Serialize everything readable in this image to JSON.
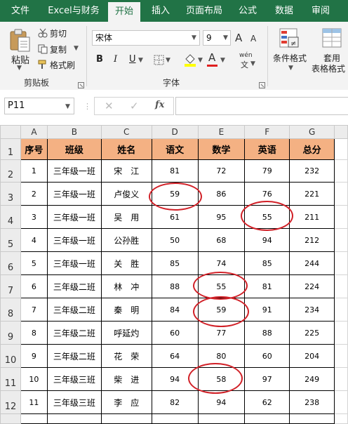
{
  "tabs": [
    "文件",
    "Excel与财务",
    "开始",
    "插入",
    "页面布局",
    "公式",
    "数据",
    "审阅"
  ],
  "clipboard": {
    "paste_label": "粘贴",
    "cut_label": "剪切",
    "copy_label": "复制",
    "format_painter_label": "格式刷",
    "group_label": "剪贴板"
  },
  "font": {
    "name_value": "宋体",
    "size_value": "9",
    "bold_label": "B",
    "italic_label": "I",
    "underline_label": "U",
    "grow_label": "A",
    "shrink_label": "A",
    "wen_label": "wén",
    "font_color_label": "A",
    "group_label": "字体"
  },
  "styles": {
    "conditional_label": "条件格式",
    "table_label_1": "套用",
    "table_label_2": "表格格式"
  },
  "formula_bar": {
    "name_box": "P11",
    "fx_label": "fx",
    "formula_value": ""
  },
  "colors": {
    "ribbon_green": "#217346",
    "header_fill": "#f4b183",
    "circle_red": "#d12027"
  },
  "sheet": {
    "columns": [
      "A",
      "B",
      "C",
      "D",
      "E",
      "F",
      "G"
    ],
    "row_numbers": [
      "1",
      "2",
      "3",
      "4",
      "5",
      "6",
      "7",
      "8",
      "9",
      "10",
      "11",
      "12"
    ],
    "headers": [
      "序号",
      "班级",
      "姓名",
      "语文",
      "数学",
      "英语",
      "总分"
    ],
    "rows": [
      [
        "1",
        "三年级一班",
        "宋　江",
        "81",
        "72",
        "79",
        "232"
      ],
      [
        "2",
        "三年级一班",
        "卢俊义",
        "59",
        "86",
        "76",
        "221"
      ],
      [
        "3",
        "三年级一班",
        "吴　用",
        "61",
        "95",
        "55",
        "211"
      ],
      [
        "4",
        "三年级一班",
        "公孙胜",
        "50",
        "68",
        "94",
        "212"
      ],
      [
        "5",
        "三年级一班",
        "关　胜",
        "85",
        "74",
        "85",
        "244"
      ],
      [
        "6",
        "三年级二班",
        "林　冲",
        "88",
        "55",
        "81",
        "224"
      ],
      [
        "7",
        "三年级二班",
        "秦　明",
        "84",
        "59",
        "91",
        "234"
      ],
      [
        "8",
        "三年级二班",
        "呼延灼",
        "60",
        "77",
        "88",
        "225"
      ],
      [
        "9",
        "三年级二班",
        "花　荣",
        "64",
        "80",
        "60",
        "204"
      ],
      [
        "10",
        "三年级三班",
        "柴　进",
        "94",
        "58",
        "97",
        "249"
      ],
      [
        "11",
        "三年级三班",
        "李　应",
        "82",
        "94",
        "62",
        "238"
      ]
    ]
  }
}
